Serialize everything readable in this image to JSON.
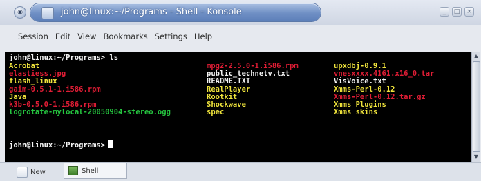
{
  "window": {
    "title": "john@linux:~/Programs - Shell - Konsole",
    "system_icon": "window-menu-icon",
    "app_icon": "konsole-icon",
    "buttons": [
      "minimize-icon",
      "maximize-icon",
      "close-icon"
    ],
    "button_glyphs": [
      "_",
      "□",
      "×"
    ]
  },
  "menubar": {
    "items": [
      "Session",
      "Edit",
      "View",
      "Bookmarks",
      "Settings",
      "Help"
    ]
  },
  "terminal": {
    "prompt_line": "john@linux:~/Programs> ls",
    "final_prompt": "john@linux:~/Programs>",
    "colors": {
      "background": "#000000",
      "text": "#f3f3f3",
      "directory": "#f0e43c",
      "archive": "#e01d35",
      "executable": "#25c43f"
    },
    "columns": [
      {
        "items": [
          {
            "name": "Acrobat",
            "type": "directory"
          },
          {
            "name": "elastiess.jpg",
            "type": "archive"
          },
          {
            "name": "flash_linux",
            "type": "directory"
          },
          {
            "name": "gaim-0.5.1-1.i586.rpm",
            "type": "archive"
          },
          {
            "name": "Java",
            "type": "directory"
          },
          {
            "name": "k3b-0.5.0-1.i586.rpm",
            "type": "archive"
          },
          {
            "name": "logrotate-mylocal-20050904-stereo.ogg",
            "type": "executable"
          }
        ]
      },
      {
        "items": [
          {
            "name": "mpg2-2.5.0-1.i586.rpm",
            "type": "archive"
          },
          {
            "name": "public_technetv.txt",
            "type": "text"
          },
          {
            "name": "README.TXT",
            "type": "text"
          },
          {
            "name": "RealPlayer",
            "type": "directory"
          },
          {
            "name": "Rootkit",
            "type": "directory"
          },
          {
            "name": "Shockwave",
            "type": "directory"
          },
          {
            "name": "spec",
            "type": "directory"
          }
        ]
      },
      {
        "items": [
          {
            "name": "upxdbj-0.9.1",
            "type": "directory"
          },
          {
            "name": "vnesxxxx.4161.x16_0.tar",
            "type": "archive"
          },
          {
            "name": "VisVoice.txt",
            "type": "text"
          },
          {
            "name": "Xmms-Perl-0.12",
            "type": "directory"
          },
          {
            "name": "Xmms-Perl-0.12.tar.gz",
            "type": "archive"
          },
          {
            "name": "Xmms Plugins",
            "type": "directory"
          },
          {
            "name": "Xmms skins",
            "type": "directory"
          }
        ]
      }
    ]
  },
  "scrollbar": {
    "up_glyph": "▲",
    "down_glyph": "▼"
  },
  "tabs": {
    "new_label": "New",
    "active_label": "Shell"
  }
}
